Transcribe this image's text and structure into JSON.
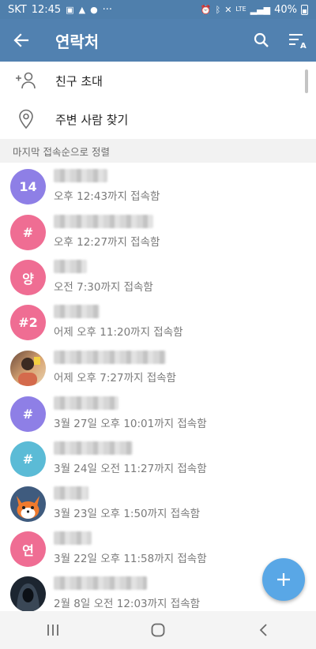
{
  "status_bar": {
    "carrier": "SKT",
    "time": "12:45",
    "extra": "···",
    "network": "LTE",
    "battery": "40%"
  },
  "app_bar": {
    "title": "연락처",
    "back_icon": "arrow-left-icon",
    "search_icon": "search-icon",
    "sort_icon": "sort-alpha-icon"
  },
  "actions": [
    {
      "label": "친구 초대",
      "icon": "add-person-icon"
    },
    {
      "label": "주변 사람 찾기",
      "icon": "location-pin-icon"
    }
  ],
  "section_header": "마지막 접속순으로 정렬",
  "contacts": [
    {
      "avatar_text": "14",
      "avatar_color": "#8e7fe6",
      "status": "오후 12:43까지 접속함"
    },
    {
      "avatar_text": "#",
      "avatar_color": "#ef6d93",
      "status": "오후 12:27까지 접속함"
    },
    {
      "avatar_text": "양",
      "avatar_color": "#ef6d93",
      "status": "오전 7:30까지 접속함"
    },
    {
      "avatar_text": "#2",
      "avatar_color": "#ef6d93",
      "status": "어제 오후 11:20까지 접속함"
    },
    {
      "avatar_text": "",
      "avatar_color": "#b98a6a",
      "status": "어제 오후 7:27까지 접속함"
    },
    {
      "avatar_text": "#",
      "avatar_color": "#8e7fe6",
      "status": "3월 27일 오후 10:01까지 접속함"
    },
    {
      "avatar_text": "#",
      "avatar_color": "#5bbbd6",
      "status": "3월 24일 오전 11:27까지 접속함"
    },
    {
      "avatar_text": "",
      "avatar_color": "#3f5b7e",
      "status": "3월 23일 오후 1:50까지 접속함"
    },
    {
      "avatar_text": "연",
      "avatar_color": "#ef6d93",
      "status": "3월 22일 오후 11:58까지 접속함"
    },
    {
      "avatar_text": "",
      "avatar_color": "#1c2530",
      "status": "2월 8일 오전 12:03까지 접속함"
    }
  ],
  "fab_icon": "plus-icon",
  "nav": [
    "recent-apps-icon",
    "home-icon",
    "back-icon"
  ]
}
